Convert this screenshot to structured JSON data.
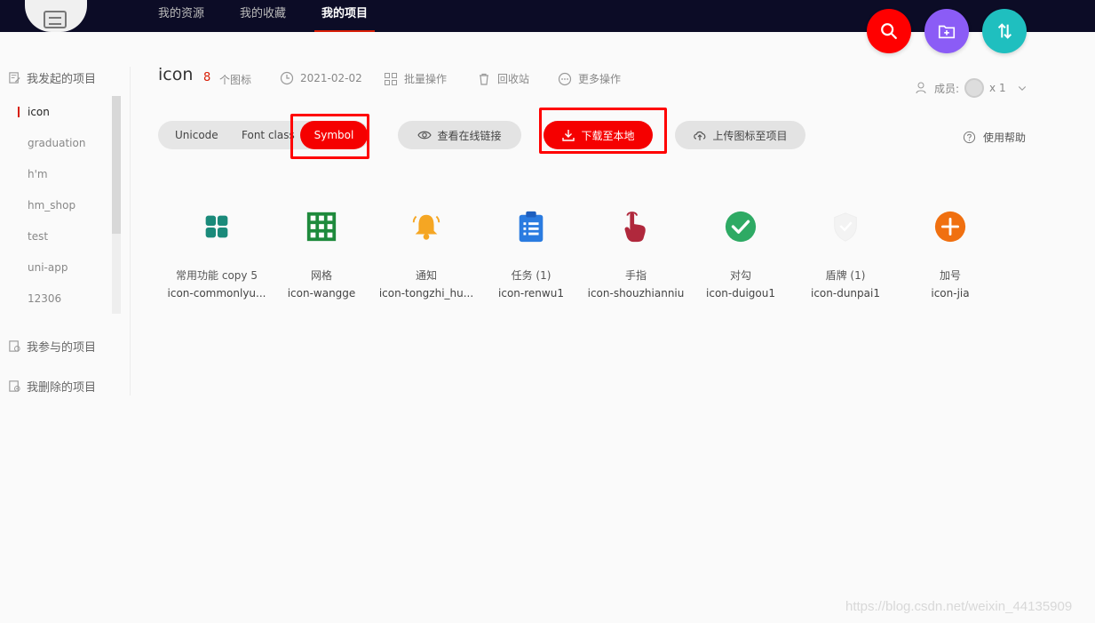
{
  "nav": {
    "items": [
      {
        "label": "我的资源"
      },
      {
        "label": "我的收藏"
      },
      {
        "label": "我的项目"
      }
    ]
  },
  "fabs": [
    {
      "icon": "search-icon",
      "color": "#ff0000"
    },
    {
      "icon": "add-folder-icon",
      "color": "#8b5cf6"
    },
    {
      "icon": "sort-icon",
      "color": "#1fbfbf"
    }
  ],
  "sidebar": {
    "my_projects": "我发起的项目",
    "projects": [
      "icon",
      "graduation",
      "h'm",
      "hm_shop",
      "test",
      "uni-app",
      "12306"
    ],
    "joined": "我参与的项目",
    "deleted": "我删除的项目"
  },
  "header": {
    "title": "icon",
    "count": "8",
    "count_label": "个图标",
    "date": "2021-02-02",
    "batch": "批量操作",
    "recycle": "回收站",
    "more": "更多操作",
    "members_label": "成员:",
    "members_count": "x 1"
  },
  "toolbar": {
    "tabs": [
      "Unicode",
      "Font class",
      "Symbol"
    ],
    "view_link": "查看在线链接",
    "download": "下载至本地",
    "upload": "上传图标至项目",
    "help": "使用帮助"
  },
  "icons": [
    {
      "name": "常用功能 copy 5",
      "code": "icon-commonlyu...",
      "icon": "grid-apps-icon",
      "color": "#1a8a7a"
    },
    {
      "name": "网格",
      "code": "icon-wangge",
      "icon": "grid-icon",
      "color": "#1e8a3c"
    },
    {
      "name": "通知",
      "code": "icon-tongzhi_hu...",
      "icon": "bell-icon",
      "color": "#f5a623"
    },
    {
      "name": "任务 (1)",
      "code": "icon-renwu1",
      "icon": "clipboard-icon",
      "color": "#2a7be0"
    },
    {
      "name": "手指",
      "code": "icon-shouzhianniu",
      "icon": "finger-icon",
      "color": "#b0283c"
    },
    {
      "name": "对勾",
      "code": "icon-duigou1",
      "icon": "check-circle-icon",
      "color": "#2eaa64"
    },
    {
      "name": "盾牌 (1)",
      "code": "icon-dunpai1",
      "icon": "shield-icon",
      "color": "#f5f5f5"
    },
    {
      "name": "加号",
      "code": "icon-jia",
      "icon": "plus-circle-icon",
      "color": "#f07010"
    }
  ],
  "watermark": "https://blog.csdn.net/weixin_44135909"
}
